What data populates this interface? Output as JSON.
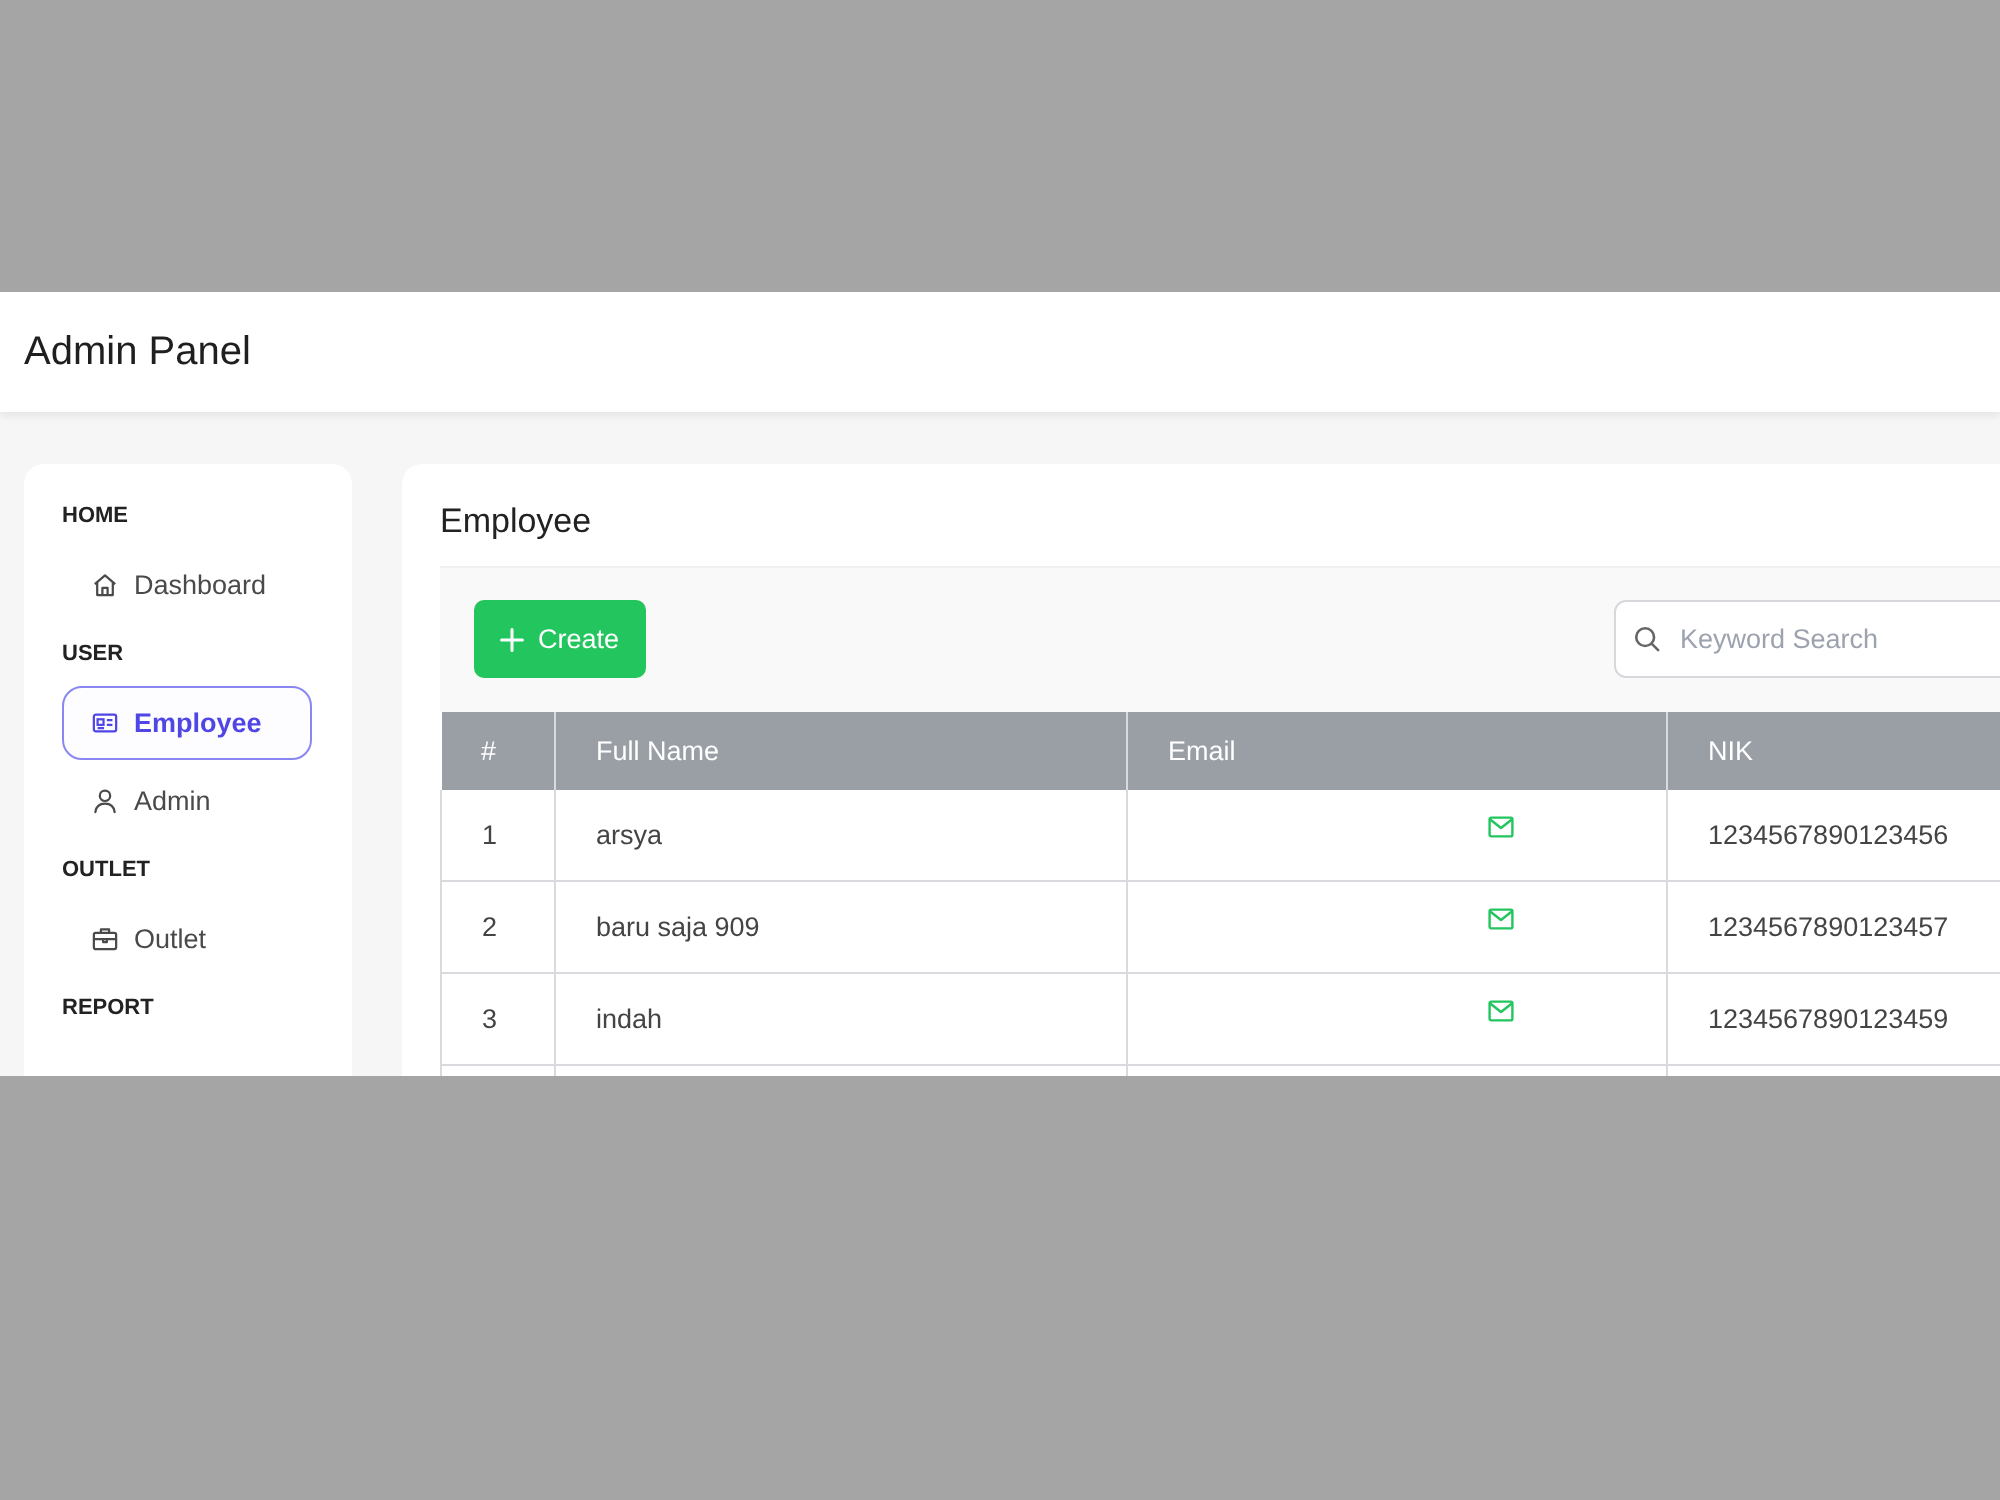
{
  "header": {
    "title": "Admin Panel"
  },
  "sidebar": {
    "sections": [
      {
        "heading": "HOME",
        "items": [
          {
            "label": "Dashboard",
            "kind": "dashboard",
            "selected": false
          }
        ]
      },
      {
        "heading": "USER",
        "items": [
          {
            "label": "Employee",
            "kind": "employee",
            "selected": true
          },
          {
            "label": "Admin",
            "kind": "admin",
            "selected": false
          }
        ]
      },
      {
        "heading": "OUTLET",
        "items": [
          {
            "label": "Outlet",
            "kind": "outlet",
            "selected": false
          }
        ]
      },
      {
        "heading": "REPORT"
      }
    ]
  },
  "content": {
    "title": "Employee",
    "create_button": {
      "label": "Create"
    },
    "search": {
      "placeholder": "Keyword Search"
    },
    "table": {
      "columns": [
        "#",
        "Full Name",
        "Email",
        "NIK"
      ],
      "rows": [
        {
          "number": "1",
          "full_name": "arsya",
          "nik": "1234567890123456"
        },
        {
          "number": "2",
          "full_name": "baru saja 909",
          "nik": "1234567890123457"
        },
        {
          "number": "3",
          "full_name": "indah",
          "nik": "1234567890123459"
        }
      ]
    }
  }
}
